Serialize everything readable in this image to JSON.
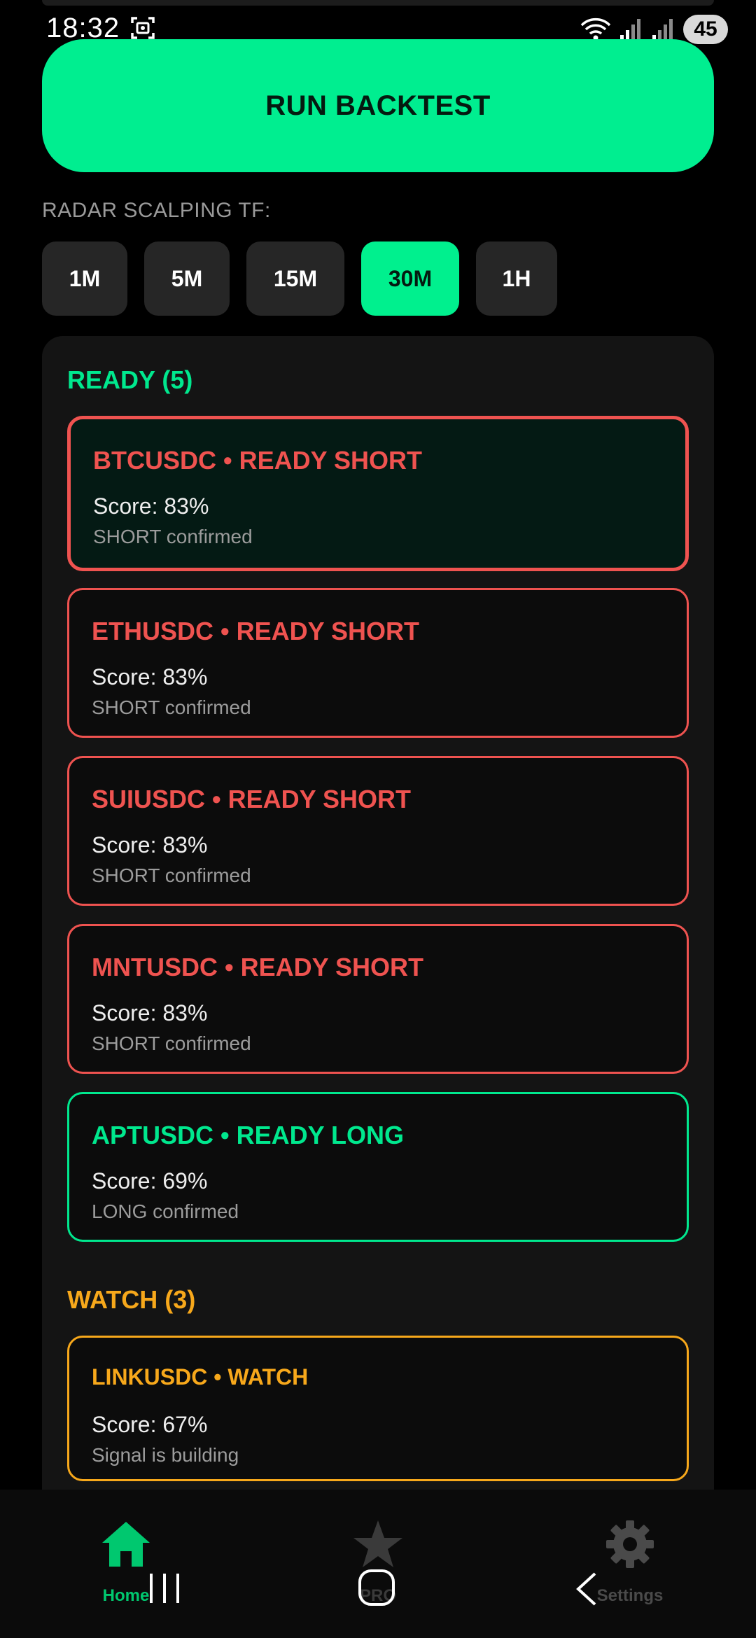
{
  "status_bar": {
    "time": "18:32",
    "battery": "45"
  },
  "run_button_label": "RUN BACKTEST",
  "timeframe_label": "RADAR SCALPING TF:",
  "timeframes": [
    "1M",
    "5M",
    "15M",
    "30M",
    "1H"
  ],
  "selected_timeframe": "30M",
  "ready_section": {
    "title": "READY (5)",
    "items": [
      {
        "title": "BTCUSDC • READY SHORT",
        "score": "Score: 83%",
        "note": "SHORT confirmed"
      },
      {
        "title": "ETHUSDC • READY SHORT",
        "score": "Score: 83%",
        "note": "SHORT confirmed"
      },
      {
        "title": "SUIUSDC • READY SHORT",
        "score": "Score: 83%",
        "note": "SHORT confirmed"
      },
      {
        "title": "MNTUSDC • READY SHORT",
        "score": "Score: 83%",
        "note": "SHORT confirmed"
      },
      {
        "title": "APTUSDC • READY LONG",
        "score": "Score: 69%",
        "note": "LONG confirmed"
      }
    ]
  },
  "watch_section": {
    "title": "WATCH (3)",
    "items": [
      {
        "title": "LINKUSDC • WATCH",
        "score": "Score: 67%",
        "note": "Signal is building"
      }
    ]
  },
  "bottom_nav": {
    "home_label": "Home",
    "pro_label": "PRO",
    "settings_label": "Settings"
  },
  "colors": {
    "accent_green": "#00ee90",
    "short_red": "#ef5350",
    "watch_orange": "#f7a81b",
    "background": "#000000",
    "panel": "#141414"
  },
  "icons": [
    "screenshot-icon",
    "wifi-icon",
    "signal-icon",
    "home-icon",
    "star-icon",
    "gear-icon",
    "recent-apps-icon",
    "home-circle-icon",
    "back-chevron-icon"
  ]
}
